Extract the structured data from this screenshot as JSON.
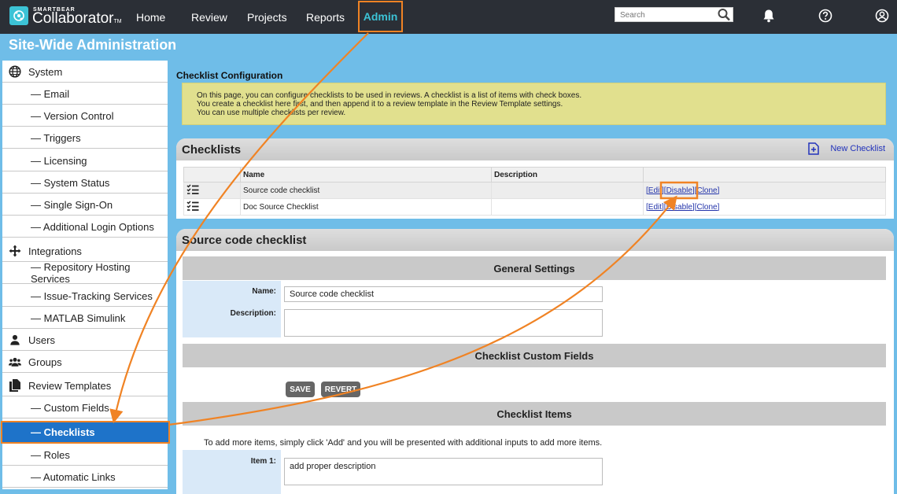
{
  "brand": {
    "top": "SMARTBEAR",
    "main": "Collaborator",
    "tm": "TM"
  },
  "nav": {
    "home": "Home",
    "review": "Review",
    "projects": "Projects",
    "reports": "Reports",
    "admin": "Admin"
  },
  "search": {
    "placeholder": "Search"
  },
  "page_title": "Site-Wide Administration",
  "sidebar": {
    "system": "System",
    "email": "— Email",
    "version_control": "— Version Control",
    "triggers": "— Triggers",
    "licensing": "— Licensing",
    "system_status": "— System Status",
    "sso": "— Single Sign-On",
    "login_options": "— Additional Login Options",
    "integrations": "Integrations",
    "repo_hosting": "— Repository Hosting Services",
    "issue_tracking": "— Issue-Tracking Services",
    "matlab": "— MATLAB Simulink",
    "users": "Users",
    "groups": "Groups",
    "review_templates": "Review Templates",
    "custom_fields": "— Custom Fields",
    "checklists": "— Checklists",
    "roles": "— Roles",
    "automatic_links": "— Automatic Links"
  },
  "config": {
    "title": "Checklist Configuration",
    "info1": "On this page, you can configure checklists to be used in reviews. A checklist is a list of items with check boxes.",
    "info2": "You create a checklist here first, and then append it to a review template in the Review Template settings.",
    "info3": "You can use multiple checklists per review."
  },
  "checklists": {
    "title": "Checklists",
    "new_label": "New Checklist",
    "col_name": "Name",
    "col_desc": "Description",
    "rows": [
      {
        "name": "Source code checklist",
        "desc": "",
        "edit": "[Edit]",
        "disable": "[Disable]",
        "clone": "[Clone]"
      },
      {
        "name": "Doc Source Checklist",
        "desc": "",
        "edit": "[Edit]",
        "disable": "[Disable]",
        "clone": "[Clone]"
      }
    ]
  },
  "detail": {
    "title": "Source code checklist",
    "general": "General Settings",
    "name_label": "Name:",
    "name_value": "Source code checklist",
    "desc_label": "Description:",
    "desc_value": "",
    "custom_fields": "Checklist Custom Fields",
    "save": "SAVE",
    "revert": "REVERT",
    "items_title": "Checklist Items",
    "items_hint": "To add more items, simply click 'Add' and you will be presented with additional inputs to add more items.",
    "item1_label": "Item 1:",
    "item1_value": "add proper description"
  },
  "colors": {
    "accent": "#3cc3d6",
    "annotation": "#f08324",
    "active": "#1e73c9",
    "background": "#6fbde8"
  }
}
